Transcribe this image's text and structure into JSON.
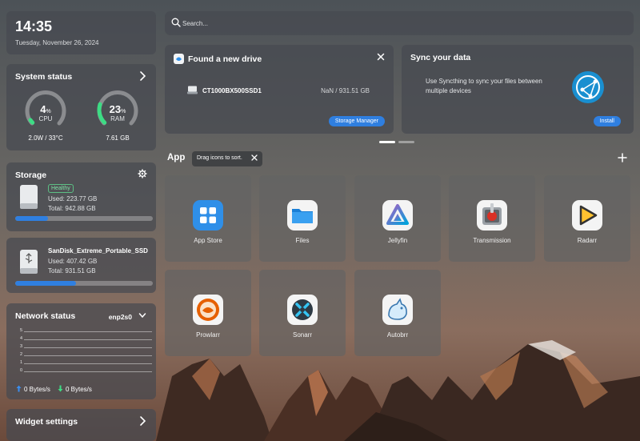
{
  "clock": {
    "time": "14:35",
    "date": "Tuesday, November 26, 2024"
  },
  "system_status": {
    "title": "System status",
    "cpu": {
      "value": "4",
      "unit": "%",
      "label": "CPU",
      "detail": "2.0W / 33°C",
      "fraction": 0.04
    },
    "ram": {
      "value": "23",
      "unit": "%",
      "label": "RAM",
      "detail": "7.61 GB",
      "fraction": 0.23
    }
  },
  "storage": {
    "title": "Storage",
    "badge": "Healthy",
    "used": "Used: 223.77 GB",
    "total": "Total: 942.88 GB",
    "fraction": 0.24
  },
  "ssd": {
    "name": "SanDisk_Extreme_Portable_SSD",
    "used": "Used: 407.42 GB",
    "total": "Total: 931.51 GB",
    "fraction": 0.44
  },
  "network": {
    "title": "Network status",
    "interface": "enp2s0",
    "axis": [
      "5",
      "4",
      "3",
      "2",
      "1",
      "0"
    ],
    "upload": "0 Bytes/s",
    "download": "0 Bytes/s"
  },
  "widget_settings": {
    "label": "Widget settings"
  },
  "search": {
    "placeholder": "Search..."
  },
  "new_drive": {
    "title": "Found a new drive",
    "drive_name": "CT1000BX500SSD1",
    "drive_size": "NaN / 931.51 GB",
    "button": "Storage Manager"
  },
  "sync": {
    "title": "Sync your data",
    "description": "Use Syncthing to sync your files between multiple devices",
    "button": "Install"
  },
  "apps": {
    "title": "App",
    "tooltip": "Drag icons to sort.",
    "items": [
      {
        "name": "App Store",
        "icon": "app-store-icon"
      },
      {
        "name": "Files",
        "icon": "files-icon"
      },
      {
        "name": "Jellyfin",
        "icon": "jellyfin-icon"
      },
      {
        "name": "Transmission",
        "icon": "transmission-icon"
      },
      {
        "name": "Radarr",
        "icon": "radarr-icon"
      },
      {
        "name": "Prowlarr",
        "icon": "prowlarr-icon"
      },
      {
        "name": "Sonarr",
        "icon": "sonarr-icon"
      },
      {
        "name": "Autobrr",
        "icon": "autobrr-icon"
      }
    ]
  },
  "colors": {
    "accent": "#2f7fe0",
    "gauge_cpu": "#3ddc84",
    "gauge_ram": "#3ddc84",
    "healthy": "#7de3a4"
  }
}
